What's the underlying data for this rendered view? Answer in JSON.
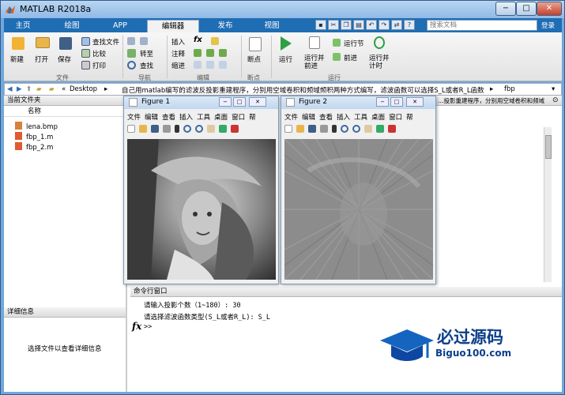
{
  "window": {
    "title": "MATLAB R2018a",
    "min_label": "−",
    "max_label": "□",
    "close_label": "✕"
  },
  "tabs": [
    "主页",
    "绘图",
    "APP",
    "编辑器",
    "发布",
    "视图"
  ],
  "active_tab": "编辑器",
  "search": {
    "placeholder": "搜索文档"
  },
  "login_label": "登录",
  "ribbon": {
    "file": {
      "new": "新建",
      "open": "打开",
      "save": "保存",
      "find_files": "查找文件",
      "compare": "比较",
      "print": "打印",
      "section": "文件"
    },
    "nav": {
      "goto": "转至",
      "find": "查找",
      "section": "导航"
    },
    "edit": {
      "insert": "插入",
      "comment": "注释",
      "indent": "缩进",
      "fx": "fx",
      "section": "编辑"
    },
    "breakpoint": {
      "label": "断点",
      "section": "断点"
    },
    "run": {
      "run": "运行",
      "run_advance": "运行并\n前进",
      "run_section": "运行节",
      "advance": "前进",
      "run_time": "运行并\n计时",
      "section": "运行"
    }
  },
  "address": {
    "prefix": "«",
    "desktop": "Desktop",
    "sep": "▸",
    "folder": "自己用matlab编写的滤波反投影重建程序，分别用空域卷积和频域频积两种方式编写，滤波函数可以选择S_L或者R_L函数",
    "leaf": "fbp"
  },
  "current_folder": {
    "title": "当前文件夹",
    "col_name": "名称",
    "files": [
      "lena.bmp",
      "fbp_1.m",
      "fbp_2.m"
    ]
  },
  "details": {
    "title": "详细信息",
    "hint": "选择文件以查看详细信息"
  },
  "editor_tab_tail": "…投影重建程序，分别用空域卷积和频域",
  "figures": [
    {
      "title": "Figure 1",
      "menu": [
        "文件",
        "编辑",
        "查看",
        "插入",
        "工具",
        "桌面",
        "窗口",
        "帮"
      ]
    },
    {
      "title": "Figure 2",
      "menu": [
        "文件",
        "编辑",
        "查看",
        "插入",
        "工具",
        "桌面",
        "窗口",
        "帮"
      ]
    }
  ],
  "command_window": {
    "title": "命令行窗口",
    "lines": [
      "请输入投影个数（1~180）: 30",
      "请选择滤波函数类型(S_L或者R_L): S_L"
    ],
    "prompt": ">>",
    "fx": "fx"
  },
  "watermark": {
    "cn": "必过源码",
    "en": "Biguo100.com"
  }
}
